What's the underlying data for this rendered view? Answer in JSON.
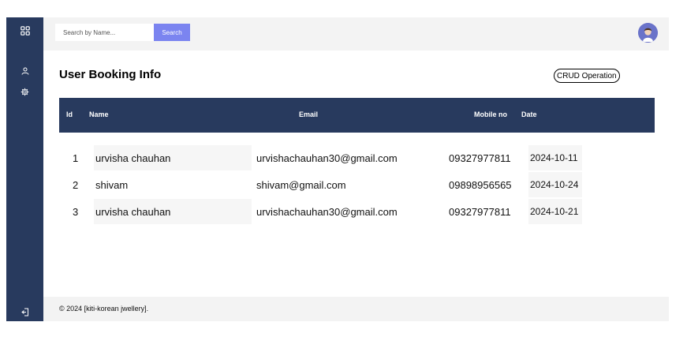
{
  "sidebar": {
    "icons": [
      "grid-icon",
      "user-icon",
      "gear-icon",
      "logout-icon"
    ]
  },
  "topbar": {
    "search_placeholder": "Search by Name...",
    "search_label": "Search",
    "avatar_icon": "avatar"
  },
  "main": {
    "title": "User Booking Info",
    "crud_label": "CRUD Operation",
    "columns": [
      "Id",
      "Name",
      "Email",
      "Mobile no",
      "Date"
    ],
    "rows": [
      {
        "id": "1",
        "name": "urvisha chauhan",
        "email": "urvishachauhan30@gmail.com",
        "mobile": "09327977811",
        "date": "2024-10-11"
      },
      {
        "id": "2",
        "name": "shivam",
        "email": "shivam@gmail.com",
        "mobile": "09898956565",
        "date": "2024-10-24"
      },
      {
        "id": "3",
        "name": "urvisha chauhan",
        "email": "urvishachauhan30@gmail.com",
        "mobile": "09327977811",
        "date": "2024-10-21"
      }
    ]
  },
  "footer": {
    "text": "© 2024 [kiti-korean jwellery]."
  },
  "colors": {
    "sidebar": "#283a5e",
    "accent": "#7b84f0",
    "topbar": "#f3f3f3"
  }
}
